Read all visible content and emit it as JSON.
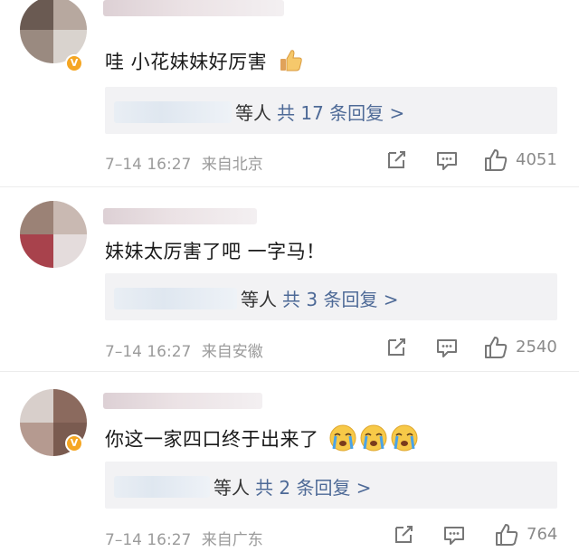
{
  "comments": [
    {
      "content": "哇 小花妹妹好厉害",
      "emoji": "thumbs-up-emoji",
      "reply_suffix": "等人",
      "reply_link": "共 17 条回复 >",
      "time": "7–14 16:27",
      "location": "来自北京",
      "likes": "4051",
      "verified": "V"
    },
    {
      "content": "妹妹太厉害了吧 一字马！",
      "emoji": "",
      "reply_suffix": "等人",
      "reply_link": "共 3 条回复 >",
      "time": "7–14 16:27",
      "location": "来自安徽",
      "likes": "2540",
      "verified": ""
    },
    {
      "content": "你这一家四口终于出来了",
      "emoji": "crying-face-emoji",
      "reply_suffix": "等人",
      "reply_link": "共 2 条回复 >",
      "time": "7–14 16:27",
      "location": "来自广东",
      "likes": "764",
      "verified": "V"
    }
  ],
  "icons": {
    "share": "share-icon",
    "comment": "comment-icon",
    "like": "like-icon"
  },
  "colors": {
    "link": "#4e6a97",
    "meta": "#9b9b9b",
    "reply_bg": "#f2f2f4",
    "badge": "#f5a623"
  }
}
